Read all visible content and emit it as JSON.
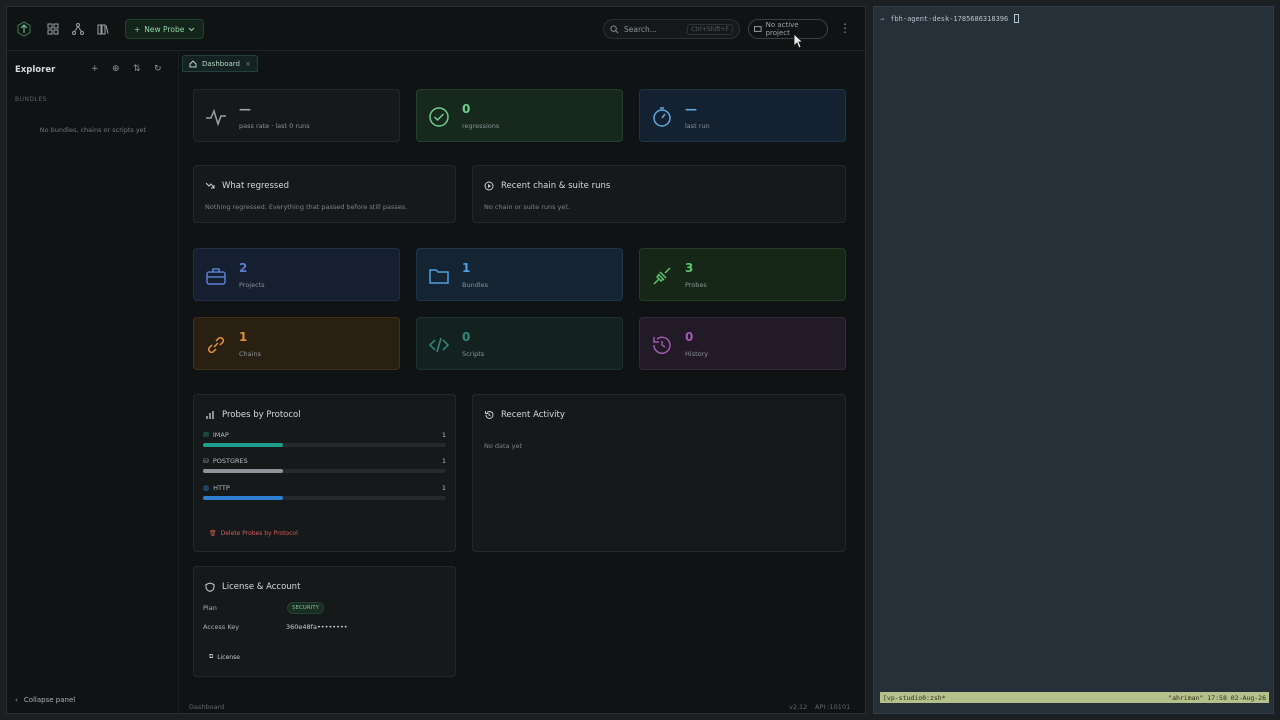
{
  "topbar": {
    "new_probe_label": "New Probe",
    "search_placeholder": "Search...",
    "search_shortcut": "Ctrl+Shift+F",
    "project_button": "No active project"
  },
  "sidebar": {
    "title": "Explorer",
    "section": "BUNDLES",
    "empty": "No bundles, chains or scripts yet",
    "collapse": "Collapse panel"
  },
  "tab": {
    "label": "Dashboard"
  },
  "top_stats": [
    {
      "value": "—",
      "label": "pass rate · last 0 runs",
      "color": "#9aa2a6"
    },
    {
      "value": "0",
      "label": "regressions",
      "color": "#6fcf8f"
    },
    {
      "value": "—",
      "label": "last run",
      "color": "#5fa8e0"
    }
  ],
  "regressed": {
    "title": "What regressed",
    "text": "Nothing regressed. Everything that passed before still passes."
  },
  "recent_runs": {
    "title": "Recent chain & suite runs",
    "text": "No chain or suite runs yet."
  },
  "counts": [
    {
      "value": "2",
      "label": "Projects",
      "color": "#5a7fcf"
    },
    {
      "value": "1",
      "label": "Bundles",
      "color": "#4f9fe0"
    },
    {
      "value": "3",
      "label": "Probes",
      "color": "#5cc46a"
    },
    {
      "value": "1",
      "label": "Chains",
      "color": "#e0903a"
    },
    {
      "value": "0",
      "label": "Scripts",
      "color": "#2e8a7a"
    },
    {
      "value": "0",
      "label": "History",
      "color": "#a05ab0"
    }
  ],
  "protocols": {
    "title": "Probes by Protocol",
    "items": [
      {
        "name": "IMAP",
        "count": "1",
        "color": "#1f9e8e",
        "fraction": 0.33
      },
      {
        "name": "POSTGRES",
        "count": "1",
        "color": "#8e9498",
        "fraction": 0.33
      },
      {
        "name": "HTTP",
        "count": "1",
        "color": "#2f7fd0",
        "fraction": 0.33
      }
    ],
    "delete_label": "Delete Probes by Protocol"
  },
  "activity": {
    "title": "Recent Activity",
    "text": "No data yet"
  },
  "license": {
    "title": "License & Account",
    "plan_label": "Plan",
    "plan_value": "SECURITY",
    "key_label": "Access Key",
    "key_value": "360e48fa••••••••",
    "button": "License"
  },
  "status": {
    "left": "Dashboard",
    "version": "v2.12",
    "api": "API :10101"
  },
  "terminal": {
    "prompt": "fbh-agent-desk-1785686318396",
    "tmux_left": "[vp-studio0:zsh*",
    "tmux_right": "\"ahriman\" 17:58 02-Aug-26"
  }
}
